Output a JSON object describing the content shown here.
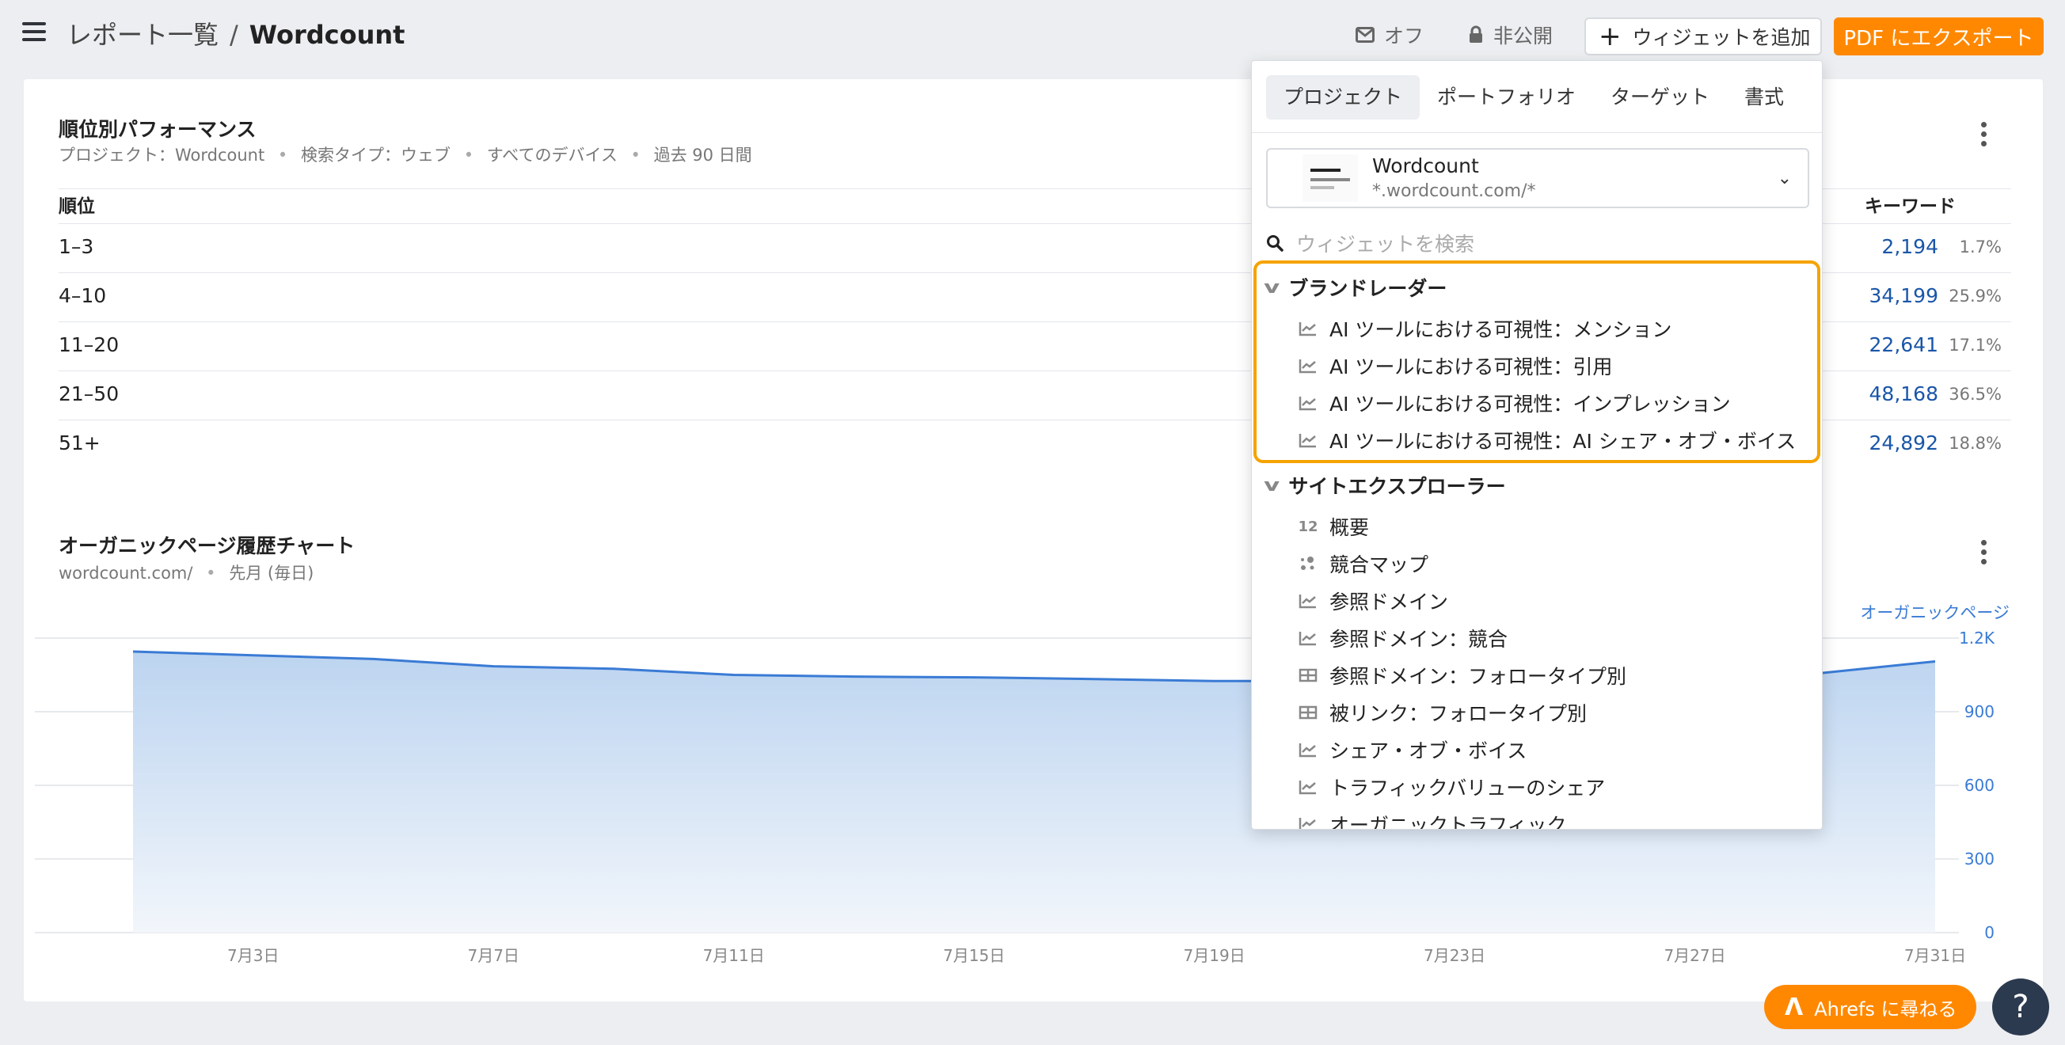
{
  "header": {
    "breadcrumb_root": "レポート一覧",
    "breadcrumb_sep": "/",
    "breadcrumb_current": "Wordcount",
    "email_label": "オフ",
    "visibility_label": "非公開",
    "add_widget_label": "ウィジェットを追加",
    "export_label": "PDF にエクスポート"
  },
  "positions_section": {
    "title": "順位別パフォーマンス",
    "filters": [
      "プロジェクト：Wordcount",
      "検索タイプ：ウェブ",
      "すべてのデバイス",
      "過去 90 日間"
    ],
    "col_position": "順位",
    "col_keywords": "キーワード",
    "rows": [
      {
        "position": "1–3",
        "keywords": "2,194",
        "pct": "1.7%"
      },
      {
        "position": "4–10",
        "keywords": "34,199",
        "pct": "25.9%"
      },
      {
        "position": "11–20",
        "keywords": "22,641",
        "pct": "17.1%"
      },
      {
        "position": "21–50",
        "keywords": "48,168",
        "pct": "36.5%"
      },
      {
        "position": "51+",
        "keywords": "24,892",
        "pct": "18.8%"
      }
    ]
  },
  "pages_section": {
    "title": "オーガニックページ履歴チャート",
    "filters": [
      "wordcount.com/",
      "先月 (毎日)"
    ]
  },
  "chart_data": {
    "type": "area",
    "series": [
      {
        "name": "オーガニックページ",
        "color": "#3a7bd5"
      }
    ],
    "x_ticks": [
      "7月3日",
      "7月7日",
      "7月11日",
      "7月15日",
      "7月19日",
      "7月23日",
      "7月27日",
      "7月31日"
    ],
    "y_ticks": [
      "0",
      "300",
      "600",
      "900",
      "1.2K"
    ],
    "ylim": [
      0,
      1200
    ],
    "x": [
      "7/1",
      "7/3",
      "7/5",
      "7/7",
      "7/9",
      "7/11",
      "7/13",
      "7/15",
      "7/17",
      "7/19",
      "7/21",
      "7/23",
      "7/25",
      "7/27",
      "7/29",
      "7/31"
    ],
    "values": [
      1145,
      1130,
      1115,
      1085,
      1075,
      1050,
      1043,
      1040,
      1033,
      1025,
      1025,
      1028,
      1045,
      1050,
      1055,
      1105
    ],
    "grid": true
  },
  "popup": {
    "tabs": [
      "プロジェクト",
      "ポートフォリオ",
      "ターゲット",
      "書式"
    ],
    "project_name": "Wordcount",
    "project_url": "*.wordcount.com/*",
    "search_placeholder": "ウィジェットを検索",
    "groups": [
      {
        "name": "ブランドレーダー",
        "items": [
          {
            "label": "AI ツールにおける可視性：メンション",
            "icon": "line-chart-icon"
          },
          {
            "label": "AI ツールにおける可視性：引用",
            "icon": "line-chart-icon"
          },
          {
            "label": "AI ツールにおける可視性：インプレッション",
            "icon": "line-chart-icon"
          },
          {
            "label": "AI ツールにおける可視性：AI シェア・オブ・ボイス",
            "icon": "line-chart-icon"
          }
        ]
      },
      {
        "name": "サイトエクスプローラー",
        "items": [
          {
            "label": "概要",
            "icon": "number-icon",
            "glyph": "12"
          },
          {
            "label": "競合マップ",
            "icon": "scatter-icon"
          },
          {
            "label": "参照ドメイン",
            "icon": "line-chart-icon"
          },
          {
            "label": "参照ドメイン：競合",
            "icon": "line-chart-icon"
          },
          {
            "label": "参照ドメイン：フォロータイプ別",
            "icon": "table-icon"
          },
          {
            "label": "被リンク：フォロータイプ別",
            "icon": "table-icon"
          },
          {
            "label": "シェア・オブ・ボイス",
            "icon": "line-chart-icon"
          },
          {
            "label": "トラフィックバリューのシェア",
            "icon": "line-chart-icon"
          },
          {
            "label": "オーガニックトラフィック",
            "icon": "line-chart-icon"
          }
        ]
      }
    ]
  },
  "assistant": {
    "label": "Ahrefs に尋ねる",
    "help": "?"
  }
}
